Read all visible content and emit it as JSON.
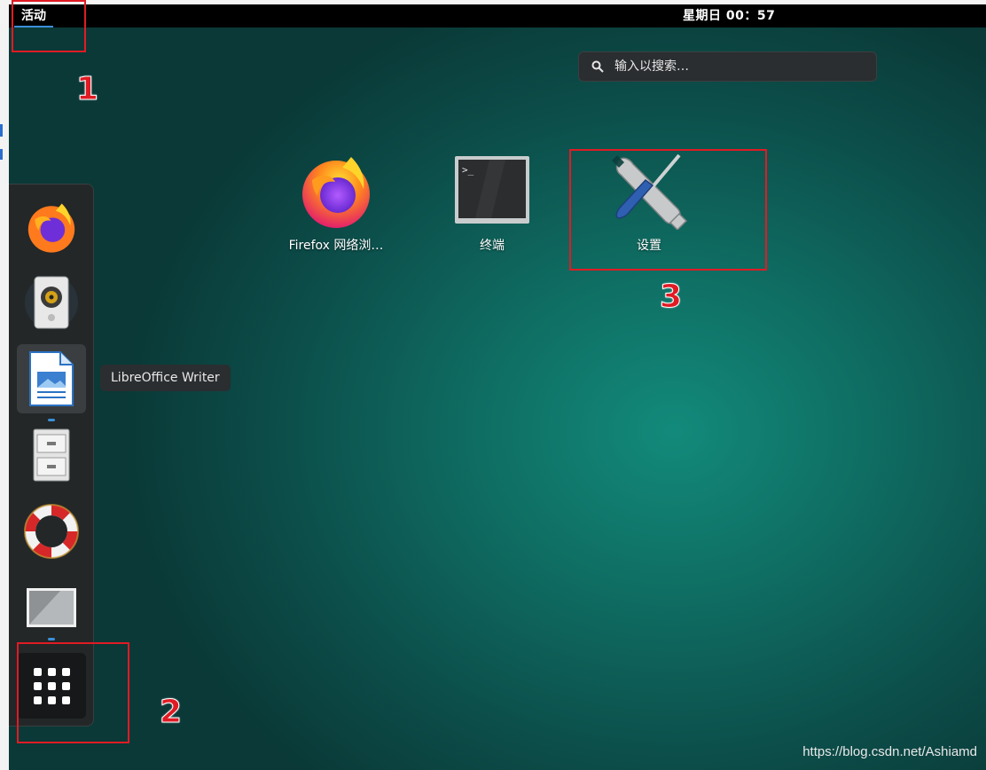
{
  "topbar": {
    "activities_label": "活动",
    "clock": "星期日 00：57"
  },
  "search": {
    "placeholder": "输入以搜索…"
  },
  "apps": [
    {
      "label": "Firefox 网络浏…",
      "icon": "firefox-icon"
    },
    {
      "label": "终端",
      "icon": "terminal-icon"
    },
    {
      "label": "设置",
      "icon": "settings-icon"
    }
  ],
  "dock": {
    "items": [
      "firefox-icon",
      "rhythmbox-speaker-icon",
      "libreoffice-writer-icon",
      "file-cabinet-icon",
      "help-lifebuoy-icon",
      "image-viewer-icon"
    ],
    "tooltip": "LibreOffice Writer",
    "show_apps": "show-applications-grid-icon"
  },
  "annotations": {
    "n1": "1",
    "n2": "2",
    "n3": "3",
    "color": "#e01b24"
  },
  "watermark": "https://blog.csdn.net/Ashiamd",
  "colors": {
    "topbar": "#000000",
    "accent": "#3b8fd8",
    "background_center": "#128a7b",
    "background_edge": "#0a3937"
  }
}
